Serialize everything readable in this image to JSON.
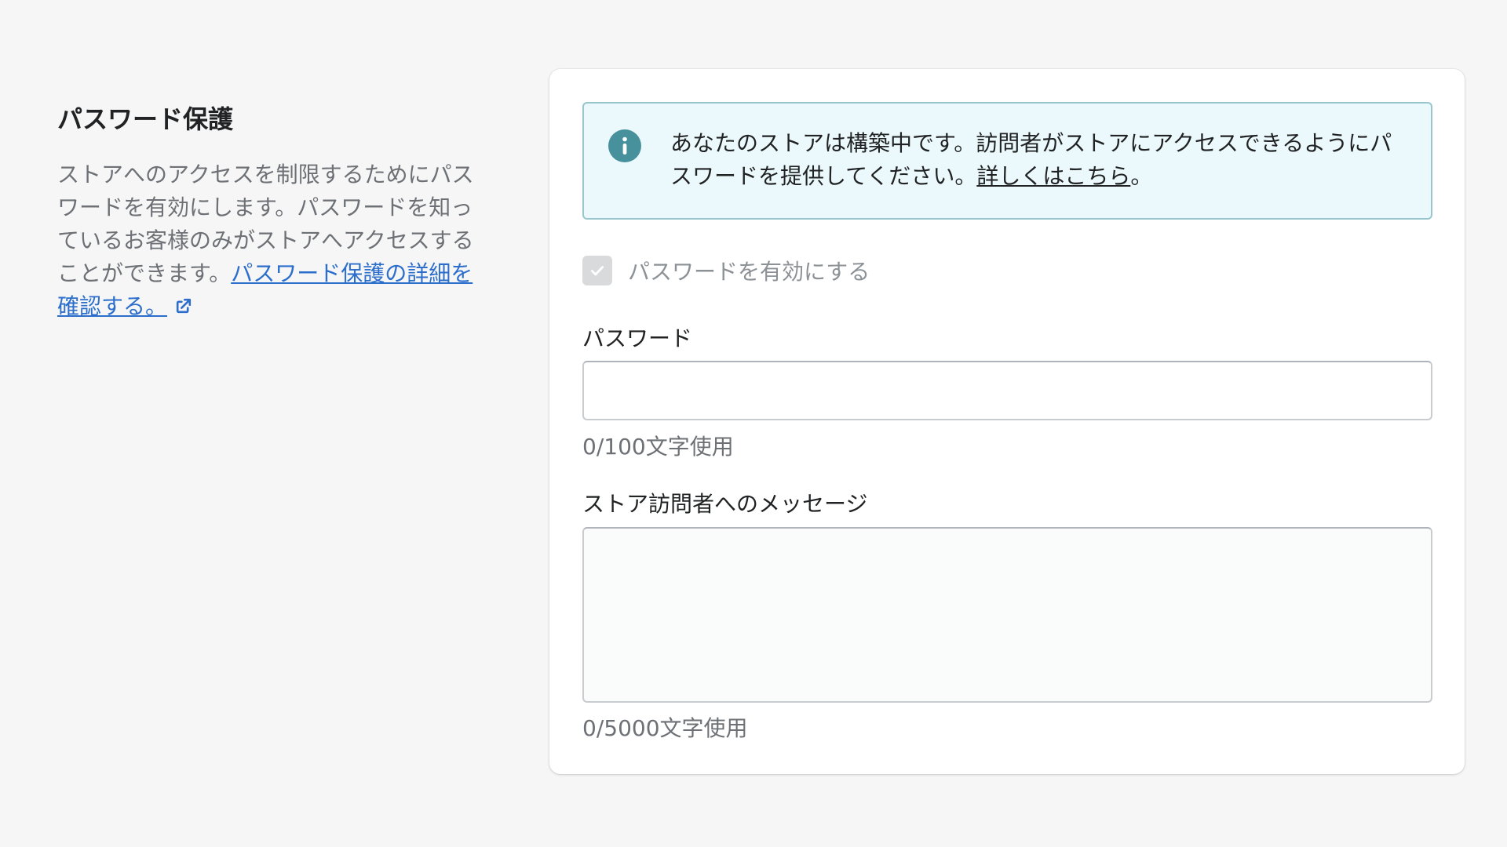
{
  "section": {
    "title": "パスワード保護",
    "description": "ストアへのアクセスを制限するためにパスワードを有効にします。パスワードを知っているお客様のみがストアへアクセスすることができます。",
    "link_text": "パスワード保護の詳細を確認する。"
  },
  "banner": {
    "text": "あなたのストアは構築中です。訪問者がストアにアクセスできるようにパスワードを提供してください。",
    "link_text": "詳しくはこちら",
    "suffix": "。",
    "icon": "info-icon",
    "color": "#ebf9fc"
  },
  "checkbox": {
    "label": "パスワードを有効にする",
    "checked": true,
    "disabled": true
  },
  "password": {
    "label": "パスワード",
    "value": "",
    "counter": "0/100文字使用"
  },
  "message": {
    "label": "ストア訪問者へのメッセージ",
    "value": "",
    "counter": "0/5000文字使用"
  }
}
